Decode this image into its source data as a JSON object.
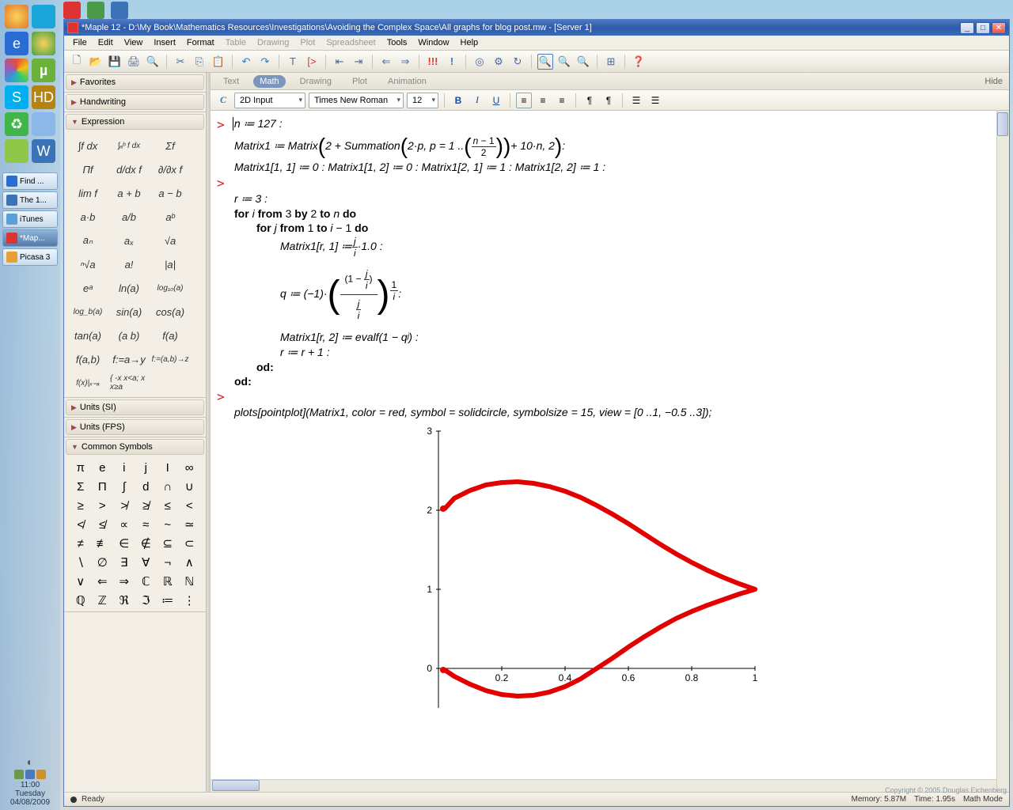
{
  "window": {
    "title": "*Maple 12 - D:\\My Book\\Mathematics Resources\\Investigations\\Avoiding the Complex Space\\All graphs for blog post.mw - [Server 1]"
  },
  "menu": [
    "File",
    "Edit",
    "View",
    "Insert",
    "Format",
    "Table",
    "Drawing",
    "Plot",
    "Spreadsheet",
    "Tools",
    "Window",
    "Help"
  ],
  "menuDisabled": [
    "Table",
    "Drawing",
    "Plot",
    "Spreadsheet"
  ],
  "palette": {
    "favorites": "Favorites",
    "handwriting": "Handwriting",
    "expression": "Expression",
    "unitsSI": "Units (SI)",
    "unitsFPS": "Units (FPS)",
    "commonSymbols": "Common Symbols"
  },
  "exprItems": [
    "∫f dx",
    "∫ₐᵇ f dx",
    "Σf",
    "Πf",
    "d/dx f",
    "∂/∂x f",
    "lim f",
    "a + b",
    "a − b",
    "a·b",
    "a/b",
    "aᵇ",
    "aₙ",
    "aₓ",
    "√a",
    "ⁿ√a",
    "a!",
    "|a|",
    "eᵃ",
    "ln(a)",
    "log₁₀(a)",
    "log_b(a)",
    "sin(a)",
    "cos(a)",
    "tan(a)",
    "(a b)",
    "f(a)",
    "f(a,b)",
    "f:=a→y",
    "f:=(a,b)→z",
    "f(x)|ₓ₌ₐ",
    "{ -x x<a; x x≥a"
  ],
  "symItems": [
    "π",
    "e",
    "i",
    "j",
    "I",
    "∞",
    "Σ",
    "Π",
    "∫",
    "d",
    "∩",
    "∪",
    "≥",
    ">",
    "≯",
    "≱",
    "≤",
    "<",
    "≮",
    "≰",
    "∝",
    "≈",
    "~",
    "≃",
    "≠",
    "≢",
    "∈",
    "∉",
    "⊆",
    "⊂",
    "∖",
    "∅",
    "∃",
    "∀",
    "¬",
    "∧",
    "∨",
    "⇐",
    "⇒",
    "ℂ",
    "ℝ",
    "ℕ",
    "ℚ",
    "ℤ",
    "ℜ",
    "ℑ",
    "≔",
    "⋮"
  ],
  "context": {
    "tabs": [
      "Text",
      "Math",
      "Drawing",
      "Plot",
      "Animation"
    ],
    "active": "Math",
    "hide": "Hide"
  },
  "format": {
    "c": "C",
    "style": "2D Input",
    "font": "Times New Roman",
    "size": "12"
  },
  "code": {
    "l1": "n ≔ 127 :",
    "l2a": "Matrix1 ≔ Matrix",
    "l2b": "2 + Summation",
    "l2c": "2·p, p = 1 ..",
    "l2d": " + 10·n, 2",
    "l2e": " :",
    "l3": "Matrix1[1, 1] ≔ 0 : Matrix1[1, 2] ≔ 0 : Matrix1[2, 1] ≔ 1 : Matrix1[2, 2] ≔ 1 :",
    "l4": "r ≔ 3 :",
    "l5": "for i from 3 by 2 to n do",
    "l6": "for j from 1 to i − 1 do",
    "l7a": "Matrix1[r, 1] ≔ ",
    "l7b": " ·1.0 :",
    "l8a": "q ≔ (−1)·",
    "l8b": " :",
    "l9": "Matrix1[r, 2] ≔ evalf(1 − qʲ) :",
    "l10": "r ≔ r + 1 :",
    "l11": "od:",
    "l12": "od:",
    "l13": "plots[pointplot](Matrix1, color = red, symbol = solidcircle, symbolsize = 15, view = [0 ..1, −0.5 ..3]);"
  },
  "chart_data": {
    "type": "scatter",
    "title": "",
    "xlabel": "",
    "ylabel": "",
    "xlim": [
      0,
      1
    ],
    "ylim": [
      -0.5,
      3
    ],
    "xticks": [
      0.2,
      0.4,
      0.6,
      0.8,
      1
    ],
    "yticks": [
      0,
      1,
      2,
      3
    ],
    "series": [
      {
        "name": "Matrix1",
        "color": "#e20000",
        "curve_upper": [
          [
            0.02,
            2.02
          ],
          [
            0.05,
            2.15
          ],
          [
            0.1,
            2.25
          ],
          [
            0.15,
            2.32
          ],
          [
            0.2,
            2.35
          ],
          [
            0.25,
            2.36
          ],
          [
            0.3,
            2.34
          ],
          [
            0.35,
            2.3
          ],
          [
            0.4,
            2.24
          ],
          [
            0.45,
            2.16
          ],
          [
            0.5,
            2.06
          ],
          [
            0.55,
            1.95
          ],
          [
            0.6,
            1.83
          ],
          [
            0.65,
            1.7
          ],
          [
            0.7,
            1.57
          ],
          [
            0.75,
            1.45
          ],
          [
            0.8,
            1.34
          ],
          [
            0.85,
            1.24
          ],
          [
            0.9,
            1.15
          ],
          [
            0.95,
            1.07
          ],
          [
            1.0,
            1.0
          ]
        ],
        "curve_lower": [
          [
            0.02,
            -0.02
          ],
          [
            0.05,
            -0.1
          ],
          [
            0.1,
            -0.2
          ],
          [
            0.15,
            -0.28
          ],
          [
            0.2,
            -0.33
          ],
          [
            0.25,
            -0.35
          ],
          [
            0.3,
            -0.34
          ],
          [
            0.35,
            -0.3
          ],
          [
            0.4,
            -0.23
          ],
          [
            0.45,
            -0.13
          ],
          [
            0.5,
            0.0
          ],
          [
            0.55,
            0.13
          ],
          [
            0.6,
            0.27
          ],
          [
            0.65,
            0.4
          ],
          [
            0.7,
            0.52
          ],
          [
            0.75,
            0.63
          ],
          [
            0.8,
            0.72
          ],
          [
            0.85,
            0.8
          ],
          [
            0.9,
            0.87
          ],
          [
            0.95,
            0.94
          ],
          [
            1.0,
            1.0
          ]
        ]
      }
    ]
  },
  "status": {
    "ready": "Ready",
    "memory": "Memory: 5.87M",
    "time": "Time: 1.95s",
    "mode": "Math Mode"
  },
  "taskButtons": [
    {
      "label": "Find ...",
      "color": "#2a6cd4"
    },
    {
      "label": "The 1...",
      "color": "#3b73b9"
    },
    {
      "label": "iTunes",
      "color": "#5aa0d8"
    },
    {
      "label": "*Map...",
      "color": "#d33",
      "active": true
    },
    {
      "label": "Picasa 3",
      "color": "#e8a030"
    }
  ],
  "clock": {
    "time": "11:00",
    "day": "Tuesday",
    "date": "04/08/2009"
  },
  "copyright": "Copyright © 2005 Douglas Eichenberg"
}
